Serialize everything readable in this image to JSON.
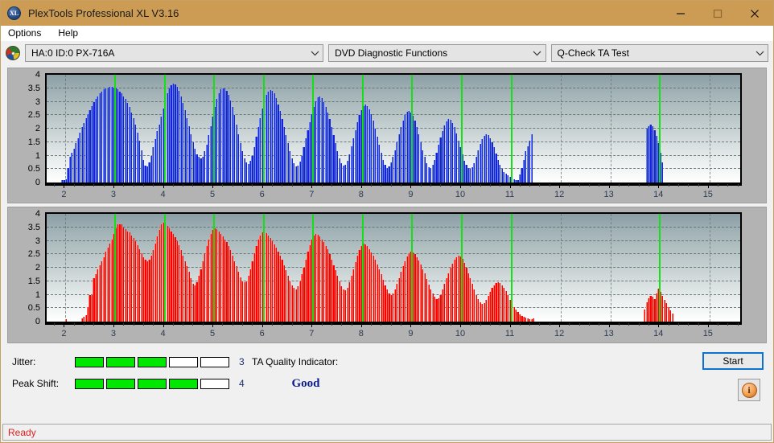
{
  "window": {
    "title": "PlexTools Professional XL V3.16",
    "app_icon": "disc-xl-icon",
    "minimize_label": "Minimize",
    "maximize_label": "Maximize",
    "close_label": "Close"
  },
  "menu": {
    "items": [
      {
        "label": "Options"
      },
      {
        "label": "Help"
      }
    ]
  },
  "toolbar": {
    "drive": "HA:0 ID:0  PX-716A",
    "function": "DVD Diagnostic Functions",
    "test": "Q-Check TA Test"
  },
  "metrics": {
    "jitter": {
      "label": "Jitter:",
      "value": "3",
      "filled": 3,
      "total": 5
    },
    "peak_shift": {
      "label": "Peak Shift:",
      "value": "4",
      "filled": 4,
      "total": 5
    }
  },
  "quality": {
    "label": "TA Quality Indicator:",
    "value": "Good",
    "color": "#0d1b8c"
  },
  "actions": {
    "start_label": "Start",
    "info_label": "i"
  },
  "status": {
    "text": "Ready"
  },
  "colors": {
    "titlebar": "#cc9c54",
    "jitter_bar": "#00e800",
    "top_series": "#1622d8",
    "bottom_series": "#fa0000",
    "marker_line": "#14e014",
    "status_text": "#e02020"
  },
  "chart_data": [
    {
      "type": "bar",
      "title": "",
      "xlabel": "",
      "ylabel": "",
      "series_color": "#1622d8",
      "marker_color": "#14e014",
      "xlim": [
        1.62,
        15.62
      ],
      "ylim": [
        0,
        4
      ],
      "yticks": [
        0,
        0.5,
        1,
        1.5,
        2,
        2.5,
        3,
        3.5,
        4
      ],
      "ytick_labels": [
        "0",
        "0.5",
        "1",
        "1.5",
        "2",
        "2.5",
        "3",
        "3.5",
        "4"
      ],
      "xticks": [
        2,
        3,
        4,
        5,
        6,
        7,
        8,
        9,
        10,
        11,
        12,
        13,
        14,
        15
      ],
      "xtick_labels": [
        "2",
        "3",
        "4",
        "5",
        "6",
        "7",
        "8",
        "9",
        "10",
        "11",
        "12",
        "13",
        "14",
        "15"
      ],
      "grid": true,
      "marker_lines": [
        3,
        4,
        5,
        6,
        7,
        8,
        9,
        10,
        11,
        14
      ],
      "bar_width": 0.035,
      "x": [
        1.93,
        1.97,
        2.01,
        2.05,
        2.09,
        2.13,
        2.17,
        2.21,
        2.25,
        2.29,
        2.33,
        2.37,
        2.41,
        2.45,
        2.49,
        2.53,
        2.57,
        2.61,
        2.65,
        2.69,
        2.73,
        2.77,
        2.81,
        2.85,
        2.89,
        2.93,
        2.97,
        3.01,
        3.05,
        3.09,
        3.13,
        3.17,
        3.21,
        3.25,
        3.29,
        3.33,
        3.37,
        3.41,
        3.45,
        3.49,
        3.53,
        3.57,
        3.61,
        3.65,
        3.69,
        3.73,
        3.77,
        3.81,
        3.85,
        3.89,
        3.93,
        3.97,
        4.01,
        4.05,
        4.09,
        4.13,
        4.17,
        4.21,
        4.25,
        4.29,
        4.33,
        4.37,
        4.41,
        4.45,
        4.49,
        4.53,
        4.57,
        4.61,
        4.65,
        4.69,
        4.73,
        4.77,
        4.81,
        4.85,
        4.89,
        4.93,
        4.97,
        5.01,
        5.05,
        5.09,
        5.13,
        5.17,
        5.21,
        5.25,
        5.29,
        5.33,
        5.37,
        5.41,
        5.45,
        5.49,
        5.53,
        5.57,
        5.61,
        5.65,
        5.69,
        5.73,
        5.77,
        5.81,
        5.85,
        5.89,
        5.93,
        5.97,
        6.01,
        6.05,
        6.09,
        6.13,
        6.17,
        6.21,
        6.25,
        6.29,
        6.33,
        6.37,
        6.41,
        6.45,
        6.49,
        6.53,
        6.57,
        6.61,
        6.65,
        6.69,
        6.73,
        6.77,
        6.81,
        6.85,
        6.89,
        6.93,
        6.97,
        7.01,
        7.05,
        7.09,
        7.13,
        7.17,
        7.21,
        7.25,
        7.29,
        7.33,
        7.37,
        7.41,
        7.45,
        7.49,
        7.53,
        7.57,
        7.61,
        7.65,
        7.69,
        7.73,
        7.77,
        7.81,
        7.85,
        7.89,
        7.93,
        7.97,
        8.01,
        8.05,
        8.09,
        8.13,
        8.17,
        8.21,
        8.25,
        8.29,
        8.33,
        8.37,
        8.41,
        8.45,
        8.49,
        8.53,
        8.57,
        8.61,
        8.65,
        8.69,
        8.73,
        8.77,
        8.81,
        8.85,
        8.89,
        8.93,
        8.97,
        9.01,
        9.05,
        9.09,
        9.13,
        9.17,
        9.21,
        9.25,
        9.29,
        9.33,
        9.37,
        9.41,
        9.45,
        9.49,
        9.53,
        9.57,
        9.61,
        9.65,
        9.69,
        9.73,
        9.77,
        9.81,
        9.85,
        9.89,
        9.93,
        9.97,
        10.01,
        10.05,
        10.09,
        10.13,
        10.17,
        10.21,
        10.25,
        10.29,
        10.33,
        10.37,
        10.41,
        10.45,
        10.49,
        10.53,
        10.57,
        10.61,
        10.65,
        10.69,
        10.73,
        10.77,
        10.81,
        10.85,
        10.89,
        10.93,
        10.97,
        11.01,
        11.05,
        11.09,
        11.13,
        11.17,
        11.21,
        11.25,
        11.29,
        11.33,
        11.37,
        11.41,
        13.73,
        13.77,
        13.81,
        13.85,
        13.89,
        13.93,
        13.97,
        14.01,
        14.05,
        14.09,
        14.13,
        14.17,
        14.21,
        14.25,
        14.29,
        14.33
      ],
      "values": [
        0.08,
        0.1,
        0.12,
        0.55,
        0.95,
        1.1,
        1.25,
        1.45,
        1.65,
        1.85,
        2.05,
        2.2,
        2.4,
        2.55,
        2.7,
        2.85,
        3.0,
        3.1,
        3.2,
        3.3,
        3.38,
        3.45,
        3.5,
        3.52,
        3.55,
        3.55,
        3.53,
        3.5,
        3.45,
        3.38,
        3.3,
        3.2,
        3.1,
        2.95,
        2.8,
        2.6,
        2.4,
        2.15,
        1.85,
        1.55,
        1.2,
        0.85,
        0.62,
        0.6,
        0.75,
        1.0,
        1.3,
        1.6,
        1.9,
        2.15,
        2.45,
        2.75,
        3.05,
        3.3,
        3.5,
        3.62,
        3.67,
        3.65,
        3.55,
        3.4,
        3.2,
        2.95,
        2.7,
        2.4,
        2.1,
        1.8,
        1.5,
        1.25,
        1.05,
        0.95,
        0.9,
        0.95,
        1.15,
        1.4,
        1.75,
        2.1,
        2.45,
        2.8,
        3.1,
        3.3,
        3.45,
        3.5,
        3.48,
        3.4,
        3.25,
        3.05,
        2.8,
        2.5,
        2.15,
        1.8,
        1.45,
        1.15,
        0.9,
        0.75,
        0.7,
        0.8,
        1.0,
        1.3,
        1.7,
        2.05,
        2.4,
        2.75,
        3.05,
        3.25,
        3.38,
        3.42,
        3.4,
        3.3,
        3.12,
        2.9,
        2.65,
        2.35,
        2.05,
        1.75,
        1.45,
        1.15,
        0.9,
        0.72,
        0.6,
        0.62,
        0.78,
        1.0,
        1.3,
        1.65,
        1.95,
        2.25,
        2.55,
        2.82,
        3.02,
        3.15,
        3.18,
        3.12,
        3.0,
        2.82,
        2.6,
        2.35,
        2.05,
        1.75,
        1.45,
        1.15,
        0.9,
        0.72,
        0.62,
        0.65,
        0.8,
        1.05,
        1.35,
        1.65,
        1.95,
        2.25,
        2.5,
        2.7,
        2.85,
        2.9,
        2.85,
        2.72,
        2.55,
        2.3,
        2.0,
        1.7,
        1.4,
        1.1,
        0.85,
        0.65,
        0.55,
        0.6,
        0.75,
        0.95,
        1.2,
        1.5,
        1.8,
        2.05,
        2.3,
        2.5,
        2.62,
        2.65,
        2.6,
        2.48,
        2.3,
        2.05,
        1.8,
        1.5,
        1.2,
        0.95,
        0.72,
        0.58,
        0.55,
        0.65,
        0.85,
        1.1,
        1.4,
        1.68,
        1.92,
        2.12,
        2.28,
        2.35,
        2.32,
        2.22,
        2.05,
        1.82,
        1.55,
        1.3,
        1.05,
        0.82,
        0.65,
        0.55,
        0.5,
        0.58,
        0.72,
        0.95,
        1.2,
        1.42,
        1.6,
        1.72,
        1.78,
        1.75,
        1.65,
        1.5,
        1.3,
        1.08,
        0.85,
        0.65,
        0.5,
        0.4,
        0.32,
        0.26,
        0.2,
        0.15,
        0.12,
        0.1,
        0.08,
        0.3,
        0.55,
        0.85,
        1.15,
        1.35,
        1.55,
        1.8,
        2.0,
        2.1,
        2.15,
        2.1,
        1.95,
        1.72,
        1.45,
        1.1,
        0.75
      ]
    },
    {
      "type": "bar",
      "title": "",
      "xlabel": "",
      "ylabel": "",
      "series_color": "#fa0000",
      "marker_color": "#14e014",
      "xlim": [
        1.62,
        15.62
      ],
      "ylim": [
        0,
        4
      ],
      "yticks": [
        0,
        0.5,
        1,
        1.5,
        2,
        2.5,
        3,
        3.5,
        4
      ],
      "ytick_labels": [
        "0",
        "0.5",
        "1",
        "1.5",
        "2",
        "2.5",
        "3",
        "3.5",
        "4"
      ],
      "xticks": [
        2,
        3,
        4,
        5,
        6,
        7,
        8,
        9,
        10,
        11,
        12,
        13,
        14,
        15
      ],
      "xtick_labels": [
        "2",
        "3",
        "4",
        "5",
        "6",
        "7",
        "8",
        "9",
        "10",
        "11",
        "12",
        "13",
        "14",
        "15"
      ],
      "grid": true,
      "marker_lines": [
        3,
        4,
        5,
        6,
        7,
        8,
        9,
        10,
        11,
        14
      ],
      "bar_width": 0.035,
      "x": [
        2.01,
        2.33,
        2.37,
        2.41,
        2.45,
        2.49,
        2.53,
        2.57,
        2.61,
        2.65,
        2.69,
        2.73,
        2.77,
        2.81,
        2.85,
        2.89,
        2.93,
        2.97,
        3.01,
        3.05,
        3.09,
        3.13,
        3.17,
        3.21,
        3.25,
        3.29,
        3.33,
        3.37,
        3.41,
        3.45,
        3.49,
        3.53,
        3.57,
        3.61,
        3.65,
        3.69,
        3.73,
        3.77,
        3.81,
        3.85,
        3.89,
        3.93,
        3.97,
        4.01,
        4.05,
        4.09,
        4.13,
        4.17,
        4.21,
        4.25,
        4.29,
        4.33,
        4.37,
        4.41,
        4.45,
        4.49,
        4.53,
        4.57,
        4.61,
        4.65,
        4.69,
        4.73,
        4.77,
        4.81,
        4.85,
        4.89,
        4.93,
        4.97,
        5.01,
        5.05,
        5.09,
        5.13,
        5.17,
        5.21,
        5.25,
        5.29,
        5.33,
        5.37,
        5.41,
        5.45,
        5.49,
        5.53,
        5.57,
        5.61,
        5.65,
        5.69,
        5.73,
        5.77,
        5.81,
        5.85,
        5.89,
        5.93,
        5.97,
        6.01,
        6.05,
        6.09,
        6.13,
        6.17,
        6.21,
        6.25,
        6.29,
        6.33,
        6.37,
        6.41,
        6.45,
        6.49,
        6.53,
        6.57,
        6.61,
        6.65,
        6.69,
        6.73,
        6.77,
        6.81,
        6.85,
        6.89,
        6.93,
        6.97,
        7.01,
        7.05,
        7.09,
        7.13,
        7.17,
        7.21,
        7.25,
        7.29,
        7.33,
        7.37,
        7.41,
        7.45,
        7.49,
        7.53,
        7.57,
        7.61,
        7.65,
        7.69,
        7.73,
        7.77,
        7.81,
        7.85,
        7.89,
        7.93,
        7.97,
        8.01,
        8.05,
        8.09,
        8.13,
        8.17,
        8.21,
        8.25,
        8.29,
        8.33,
        8.37,
        8.41,
        8.45,
        8.49,
        8.53,
        8.57,
        8.61,
        8.65,
        8.69,
        8.73,
        8.77,
        8.81,
        8.85,
        8.89,
        8.93,
        8.97,
        9.01,
        9.05,
        9.09,
        9.13,
        9.17,
        9.21,
        9.25,
        9.29,
        9.33,
        9.37,
        9.41,
        9.45,
        9.49,
        9.53,
        9.57,
        9.61,
        9.65,
        9.69,
        9.73,
        9.77,
        9.81,
        9.85,
        9.89,
        9.93,
        9.97,
        10.01,
        10.05,
        10.09,
        10.13,
        10.17,
        10.21,
        10.25,
        10.29,
        10.33,
        10.37,
        10.41,
        10.45,
        10.49,
        10.53,
        10.57,
        10.61,
        10.65,
        10.69,
        10.73,
        10.77,
        10.81,
        10.85,
        10.89,
        10.93,
        10.97,
        11.01,
        11.05,
        11.09,
        11.13,
        11.17,
        11.21,
        11.25,
        11.29,
        11.33,
        11.37,
        11.41,
        11.45,
        13.69,
        13.73,
        13.77,
        13.81,
        13.85,
        13.89,
        13.93,
        13.97,
        14.01,
        14.05,
        14.09,
        14.13,
        14.17,
        14.21,
        14.25,
        14.29
      ],
      "values": [
        0.1,
        0.12,
        0.18,
        0.25,
        0.55,
        0.98,
        1.0,
        1.6,
        1.75,
        1.95,
        2.1,
        2.25,
        2.4,
        2.6,
        2.75,
        2.9,
        3.05,
        3.25,
        3.45,
        3.6,
        3.62,
        3.6,
        3.5,
        3.42,
        3.35,
        3.3,
        3.2,
        3.1,
        3.0,
        2.85,
        2.7,
        2.55,
        2.4,
        2.3,
        2.25,
        2.3,
        2.45,
        2.65,
        2.9,
        3.15,
        3.4,
        3.6,
        3.68,
        3.65,
        3.55,
        3.45,
        3.35,
        3.25,
        3.12,
        3.0,
        2.85,
        2.65,
        2.45,
        2.25,
        2.05,
        1.85,
        1.6,
        1.4,
        1.35,
        1.45,
        1.7,
        1.95,
        2.25,
        2.55,
        2.8,
        3.05,
        3.25,
        3.4,
        3.45,
        3.42,
        3.35,
        3.25,
        3.15,
        3.05,
        2.95,
        2.8,
        2.65,
        2.45,
        2.25,
        2.05,
        1.85,
        1.65,
        1.5,
        1.45,
        1.5,
        1.7,
        1.95,
        2.25,
        2.55,
        2.8,
        3.05,
        3.2,
        3.3,
        3.32,
        3.28,
        3.2,
        3.1,
        3.0,
        2.88,
        2.75,
        2.6,
        2.45,
        2.3,
        2.1,
        1.9,
        1.7,
        1.5,
        1.35,
        1.25,
        1.2,
        1.3,
        1.5,
        1.75,
        2.0,
        2.3,
        2.6,
        2.85,
        3.05,
        3.2,
        3.25,
        3.22,
        3.15,
        3.05,
        2.95,
        2.82,
        2.68,
        2.5,
        2.3,
        2.1,
        1.9,
        1.7,
        1.5,
        1.3,
        1.18,
        1.15,
        1.25,
        1.45,
        1.7,
        1.95,
        2.2,
        2.45,
        2.65,
        2.82,
        2.9,
        2.88,
        2.8,
        2.7,
        2.58,
        2.45,
        2.3,
        2.12,
        1.95,
        1.75,
        1.55,
        1.35,
        1.18,
        1.05,
        1.0,
        1.05,
        1.2,
        1.4,
        1.62,
        1.85,
        2.05,
        2.25,
        2.42,
        2.55,
        2.6,
        2.58,
        2.5,
        2.4,
        2.28,
        2.12,
        1.95,
        1.78,
        1.58,
        1.38,
        1.2,
        1.05,
        0.92,
        0.85,
        0.88,
        1.0,
        1.18,
        1.4,
        1.6,
        1.8,
        2.0,
        2.15,
        2.3,
        2.4,
        2.45,
        2.42,
        2.32,
        2.18,
        2.0,
        1.8,
        1.6,
        1.4,
        1.18,
        1.0,
        0.85,
        0.72,
        0.65,
        0.68,
        0.8,
        0.95,
        1.1,
        1.25,
        1.35,
        1.42,
        1.45,
        1.42,
        1.35,
        1.25,
        1.12,
        0.98,
        0.82,
        0.68,
        0.55,
        0.45,
        0.35,
        0.28,
        0.22,
        0.18,
        0.15,
        0.12,
        0.1,
        0.08,
        0.12,
        0.45,
        0.72,
        0.88,
        0.95,
        0.92,
        0.85,
        1.05,
        1.22,
        1.1,
        0.95,
        0.8,
        0.68,
        0.55,
        0.42,
        0.3
      ]
    }
  ]
}
